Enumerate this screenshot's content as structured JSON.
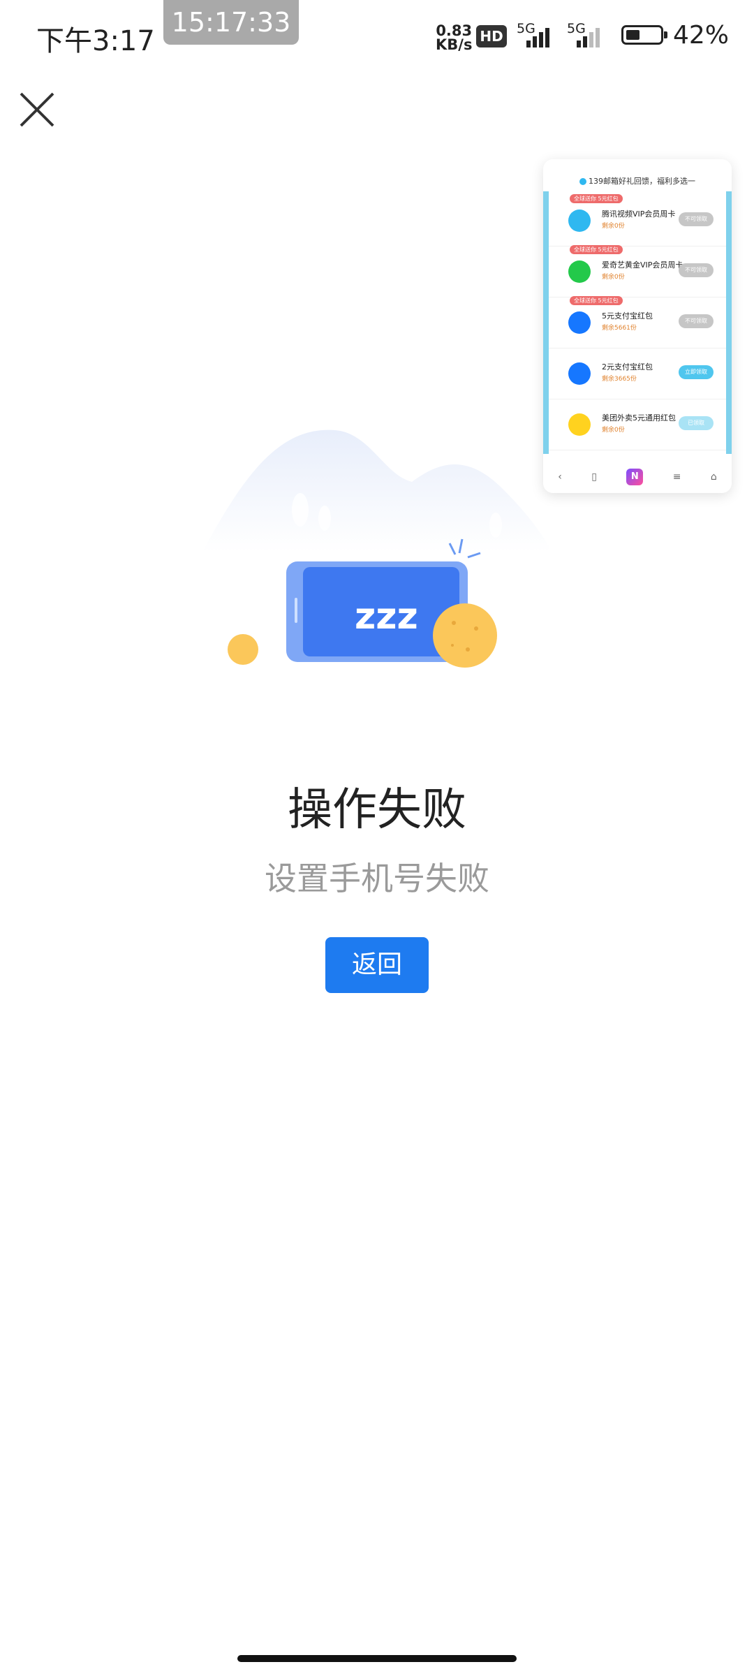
{
  "status_bar": {
    "time": "下午3:17",
    "clock_overlay": "15:17:33",
    "net_speed_value": "0.83",
    "net_speed_unit": "KB/s",
    "hd_label": "HD",
    "signal1_label": "5G",
    "signal2_label": "5G",
    "battery_percent": "42%",
    "battery_level": 0.42
  },
  "preview": {
    "header": "139邮箱好礼回馈，福利多选一",
    "items": [
      {
        "tag": "全球送你 5元红包",
        "title": "腾讯视频VIP会员周卡",
        "sub": "剩余0份",
        "button": "不可领取",
        "icon": "tencent-video-icon",
        "icon_color": "#2fb8f0",
        "button_color": "#c6c6c6"
      },
      {
        "tag": "全球送你 5元红包",
        "title": "爱奇艺黄金VIP会员周卡",
        "sub": "剩余0份",
        "button": "不可领取",
        "icon": "iqiyi-icon",
        "icon_color": "#23c94a",
        "button_color": "#c6c6c6"
      },
      {
        "tag": "全球送你 5元红包",
        "title": "5元支付宝红包",
        "sub": "剩余5661份",
        "button": "不可领取",
        "icon": "alipay-icon",
        "icon_color": "#1677ff",
        "button_color": "#c6c6c6"
      },
      {
        "tag": "",
        "title": "2元支付宝红包",
        "sub": "剩余3665份",
        "button": "立即领取",
        "icon": "alipay-icon",
        "icon_color": "#1677ff",
        "button_color": "#4fc6ee"
      },
      {
        "tag": "",
        "title": "美团外卖5元通用红包",
        "sub": "剩余0份",
        "button": "已领取",
        "icon": "meituan-icon",
        "icon_color": "#ffd21f",
        "button_color": "#a9e3f5"
      }
    ],
    "nav": [
      "‹",
      "▯",
      "N",
      "≡",
      "⌂"
    ]
  },
  "main": {
    "title": "操作失败",
    "subtitle": "设置手机号失败",
    "back_button": "返回",
    "illustration_text": "zzz"
  }
}
